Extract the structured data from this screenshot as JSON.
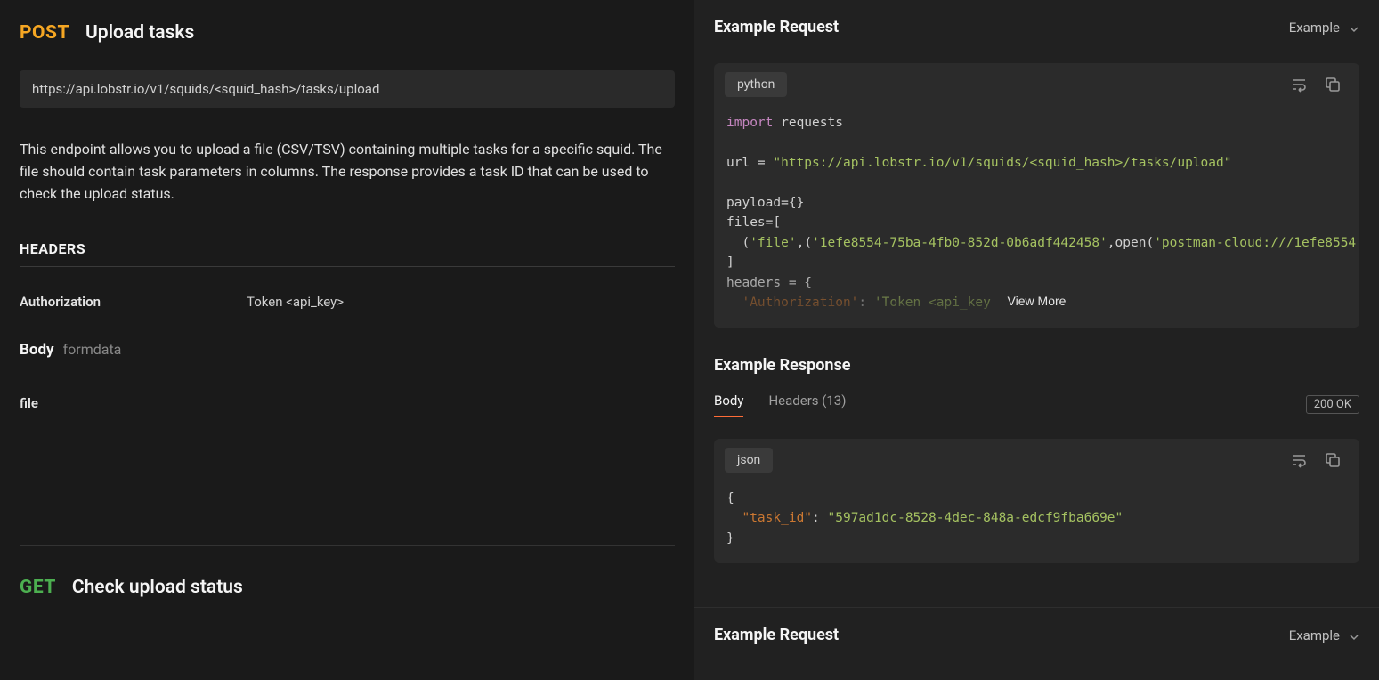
{
  "endpoint1": {
    "method": "POST",
    "title": "Upload tasks",
    "url": "https://api.lobstr.io/v1/squids/<squid_hash>/tasks/upload",
    "description": "This endpoint allows you to upload a file (CSV/TSV) containing multiple tasks for a specific squid. The file should contain task parameters in columns. The response provides a task ID that can be used to check the upload status.",
    "headers_section_label": "HEADERS",
    "headers": [
      {
        "key": "Authorization",
        "value": "Token <api_key>"
      }
    ],
    "body_section": {
      "label": "Body",
      "type": "formdata",
      "params": [
        {
          "key": "file"
        }
      ]
    }
  },
  "endpoint2": {
    "method": "GET",
    "title": "Check upload status"
  },
  "example_request": {
    "title": "Example Request",
    "dropdown_label": "Example",
    "language": "python",
    "code": {
      "line1_kw": "import",
      "line1_rest": " requests",
      "line2_a": "url = ",
      "line2_b": "\"https://api.lobstr.io/v1/squids/<squid_hash>/tasks/upload\"",
      "line3": "payload={}",
      "line4": "files=[",
      "line5_a": "  (",
      "line5_b": "'file'",
      "line5_c": ",(",
      "line5_d": "'1efe8554-75ba-4fb0-852d-0b6adf442458'",
      "line5_e": ",open(",
      "line5_f": "'postman-cloud:///1efe8554",
      "line6": "]",
      "line7": "headers = {",
      "line8_a": "  ",
      "line8_b": "'Authorization'",
      "line8_c": ": ",
      "line8_d": "'Token <api_key"
    },
    "view_more": "View More"
  },
  "example_response": {
    "title": "Example Response",
    "tabs": {
      "body": "Body",
      "headers": "Headers (13)"
    },
    "status": "200 OK",
    "language": "json",
    "code": {
      "line1": "{",
      "line2_a": "  ",
      "line2_b": "\"task_id\"",
      "line2_c": ": ",
      "line2_d": "\"597ad1dc-8528-4dec-848a-edcf9fba669e\"",
      "line3": "}"
    }
  },
  "example_request2": {
    "title": "Example Request",
    "dropdown_label": "Example"
  }
}
